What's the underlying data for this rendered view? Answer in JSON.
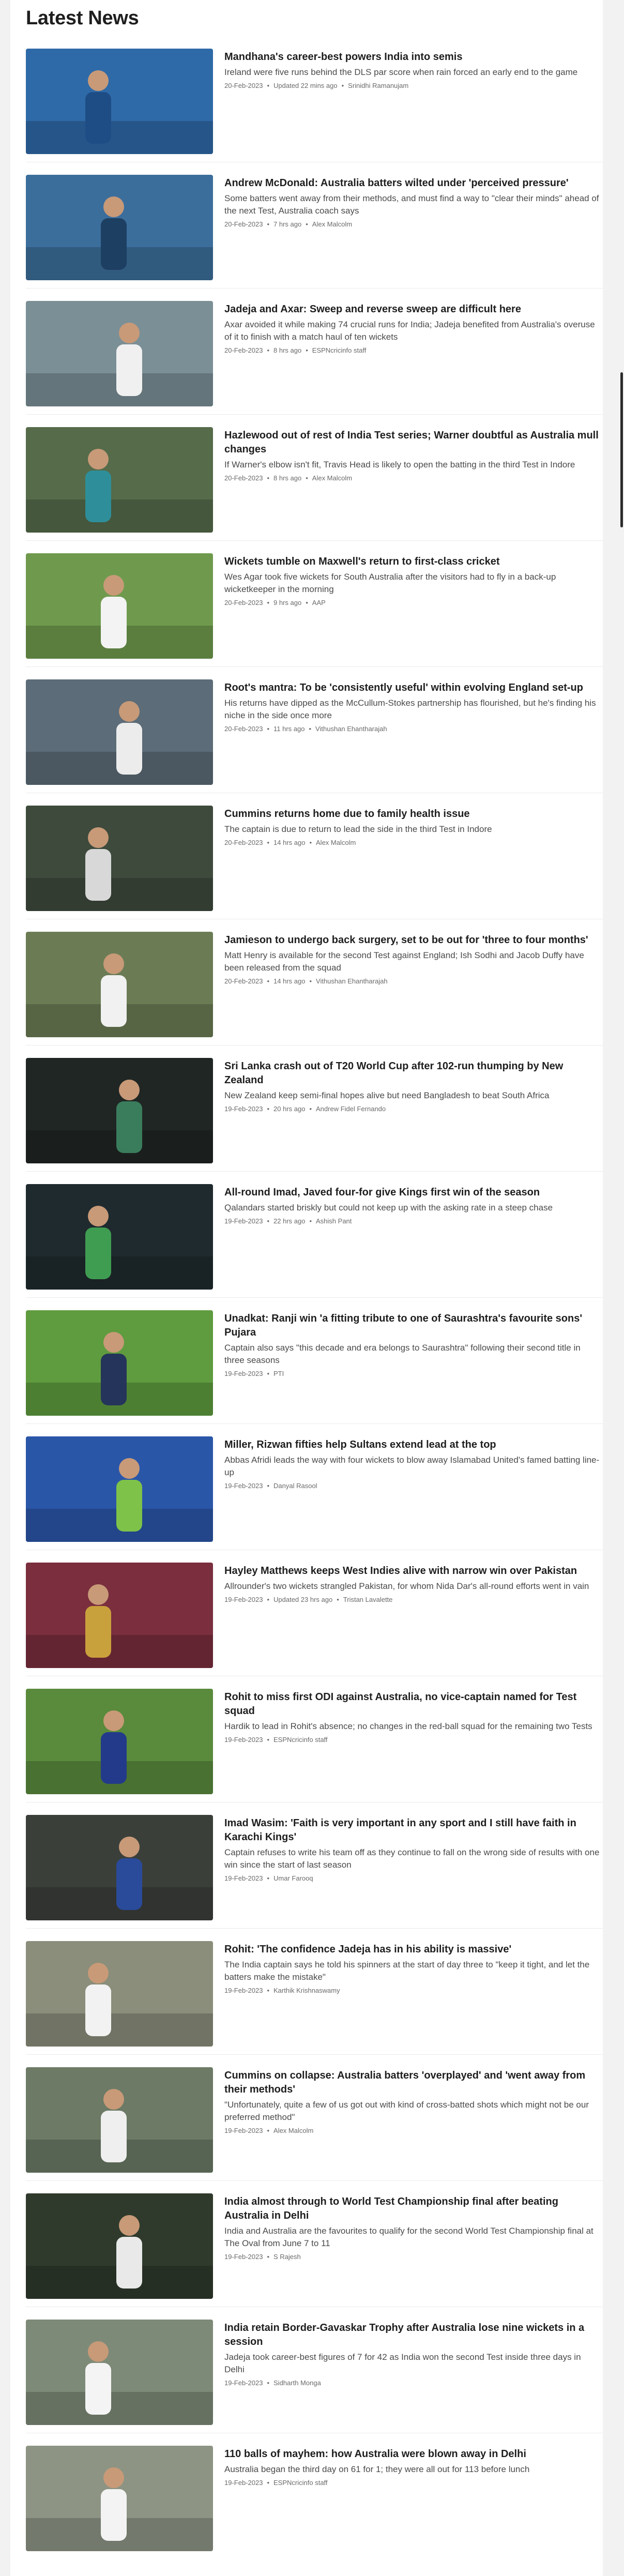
{
  "page": {
    "heading": "Latest News"
  },
  "articles": [
    {
      "title": "Mandhana's career-best powers India into semis",
      "summary": "Ireland were five runs behind the DLS par score when rain forced an early end to the game",
      "date": "20-Feb-2023",
      "updated": "Updated 22 mins ago",
      "author": "Srinidhi Ramanujam",
      "image": "batter-blue-kit-icon",
      "bg": "#2f6aa8",
      "fg": "#1e4d86"
    },
    {
      "title": "Andrew McDonald: Australia batters wilted under 'perceived pressure'",
      "summary": "Some batters went away from their methods, and must find a way to \"clear their minds\" ahead of the next Test, Australia coach says",
      "date": "20-Feb-2023",
      "updated": "7 hrs ago",
      "author": "Alex Malcolm",
      "image": "press-conference-icon",
      "bg": "#3c6e9c",
      "fg": "#1d3f61"
    },
    {
      "title": "Jadeja and Axar: Sweep and reverse sweep are difficult here",
      "summary": "Axar avoided it while making 74 crucial runs for India; Jadeja benefited from Australia's overuse of it to finish with a match haul of ten wickets",
      "date": "20-Feb-2023",
      "updated": "8 hrs ago",
      "author": "ESPNcricinfo staff",
      "image": "players-embrace-icon",
      "bg": "#7b8f96",
      "fg": "#f0f0f0"
    },
    {
      "title": "Hazlewood out of rest of India Test series; Warner doubtful as Australia mull changes",
      "summary": "If Warner's elbow isn't fit, Travis Head is likely to open the batting in the third Test in Indore",
      "date": "20-Feb-2023",
      "updated": "8 hrs ago",
      "author": "Alex Malcolm",
      "image": "two-players-talking-icon",
      "bg": "#556b4a",
      "fg": "#2e8f9a"
    },
    {
      "title": "Wickets tumble on Maxwell's return to first-class cricket",
      "summary": "Wes Agar took five wickets for South Australia after the visitors had to fly in a back-up wicketkeeper in the morning",
      "date": "20-Feb-2023",
      "updated": "9 hrs ago",
      "author": "AAP",
      "image": "batter-whites-icon",
      "bg": "#6f9a4e",
      "fg": "#f3f3f3"
    },
    {
      "title": "Root's mantra: To be 'consistently useful' within evolving England set-up",
      "summary": "His returns have dipped as the McCullum-Stokes partnership has flourished, but he's finding his niche in the side once more",
      "date": "20-Feb-2023",
      "updated": "11 hrs ago",
      "author": "Vithushan Ehantharajah",
      "image": "batter-celebrating-icon",
      "bg": "#5c6c78",
      "fg": "#ececec"
    },
    {
      "title": "Cummins returns home due to family health issue",
      "summary": "The captain is due to return to lead the side in the third Test in Indore",
      "date": "20-Feb-2023",
      "updated": "14 hrs ago",
      "author": "Alex Malcolm",
      "image": "captain-green-cap-icon",
      "bg": "#3d4a3c",
      "fg": "#d8d8d8"
    },
    {
      "title": "Jamieson to undergo back surgery, set to be out for 'three to four months'",
      "summary": "Matt Henry is available for the second Test against England; Ish Sodhi and Jacob Duffy have been released from the squad",
      "date": "20-Feb-2023",
      "updated": "14 hrs ago",
      "author": "Vithushan Ehantharajah",
      "image": "bowler-portrait-icon",
      "bg": "#6b7c55",
      "fg": "#f1f1f1"
    },
    {
      "title": "Sri Lanka crash out of T20 World Cup after 102-run thumping by New Zealand",
      "summary": "New Zealand keep semi-final hopes alive but need Bangladesh to beat South Africa",
      "date": "19-Feb-2023",
      "updated": "20 hrs ago",
      "author": "Andrew Fidel Fernando",
      "image": "batters-night-icon",
      "bg": "#202624",
      "fg": "#3a7d5d"
    },
    {
      "title": "All-round Imad, Javed four-for give Kings first win of the season",
      "summary": "Qalandars started briskly but could not keep up with the asking rate in a steep chase",
      "date": "19-Feb-2023",
      "updated": "22 hrs ago",
      "author": "Ashish Pant",
      "image": "batter-green-kit-icon",
      "bg": "#1f2a2e",
      "fg": "#3f9d52"
    },
    {
      "title": "Unadkat: Ranji win 'a fitting tribute to one of Saurashtra's favourite sons' Pujara",
      "summary": "Captain also says \"this decade and era belongs to Saurashtra\" following their second title in three seasons",
      "date": "19-Feb-2023",
      "updated": "",
      "author": "PTI",
      "image": "players-on-field-icon",
      "bg": "#5f9b3f",
      "fg": "#25345a"
    },
    {
      "title": "Miller, Rizwan fifties help Sultans extend lead at the top",
      "summary": "Abbas Afridi leads the way with four wickets to blow away Islamabad United's famed batting line-up",
      "date": "19-Feb-2023",
      "updated": "",
      "author": "Danyal Rasool",
      "image": "batter-pepsi-board-icon",
      "bg": "#2a56a8",
      "fg": "#7ec24a"
    },
    {
      "title": "Hayley Matthews keeps West Indies alive with narrow win over Pakistan",
      "summary": "Allrounder's two wickets strangled Pakistan, for whom Nida Dar's all-round efforts went in vain",
      "date": "19-Feb-2023",
      "updated": "Updated 23 hrs ago",
      "author": "Tristan Lavalette",
      "image": "team-huddle-icon",
      "bg": "#7a2e3e",
      "fg": "#c9a13c"
    },
    {
      "title": "Rohit to miss first ODI against Australia, no vice-captain named for Test squad",
      "summary": "Hardik to lead in Rohit's absence; no changes in the red-ball squad for the remaining two Tests",
      "date": "19-Feb-2023",
      "updated": "",
      "author": "ESPNcricinfo staff",
      "image": "fielder-diving-icon",
      "bg": "#5a8a3c",
      "fg": "#233a8a"
    },
    {
      "title": "Imad Wasim: 'Faith is very important in any sport and I still have faith in Karachi Kings'",
      "summary": "Captain refuses to write his team off as they continue to fall on the wrong side of results with one win since the start of last season",
      "date": "19-Feb-2023",
      "updated": "",
      "author": "Umar Farooq",
      "image": "captain-portrait-icon",
      "bg": "#3b3f3a",
      "fg": "#2a4a9a"
    },
    {
      "title": "Rohit: 'The confidence Jadeja has in his ability is massive'",
      "summary": "The India captain says he told his spinners at the start of day three to \"keep it tight, and let the batters make the mistake\"",
      "date": "19-Feb-2023",
      "updated": "",
      "author": "Karthik Krishnaswamy",
      "image": "players-celebrate-icon",
      "bg": "#8a8e7a",
      "fg": "#f2f2f2"
    },
    {
      "title": "Cummins on collapse: Australia batters 'overplayed' and 'went away from their methods'",
      "summary": "\"Unfortunately, quite a few of us got out with kind of cross-batted shots which might not be our preferred method\"",
      "date": "19-Feb-2023",
      "updated": "",
      "author": "Alex Malcolm",
      "image": "batter-stadium-icon",
      "bg": "#6c7a66",
      "fg": "#efefef"
    },
    {
      "title": "India almost through to World Test Championship final after beating Australia in Delhi",
      "summary": "India and Australia are the favourites to qualify for the second World Test Championship final at The Oval from June 7 to 11",
      "date": "19-Feb-2023",
      "updated": "",
      "author": "S Rajesh",
      "image": "players-walk-off-icon",
      "bg": "#2f3a2c",
      "fg": "#e9e9e9"
    },
    {
      "title": "India retain Border-Gavaskar Trophy after Australia lose nine wickets in a session",
      "summary": "Jadeja took career-best figures of 7 for 42 as India won the second Test inside three days in Delhi",
      "date": "19-Feb-2023",
      "updated": "",
      "author": "Sidharth Monga",
      "image": "bowler-appeal-icon",
      "bg": "#7e8a78",
      "fg": "#f4f4f4"
    },
    {
      "title": "110 balls of mayhem: how Australia were blown away in Delhi",
      "summary": "Australia began the third day on 61 for 1; they were all out for 113 before lunch",
      "date": "19-Feb-2023",
      "updated": "",
      "author": "ESPNcricinfo staff",
      "image": "fielders-run-icon",
      "bg": "#8d9484",
      "fg": "#f3f3f3"
    }
  ]
}
